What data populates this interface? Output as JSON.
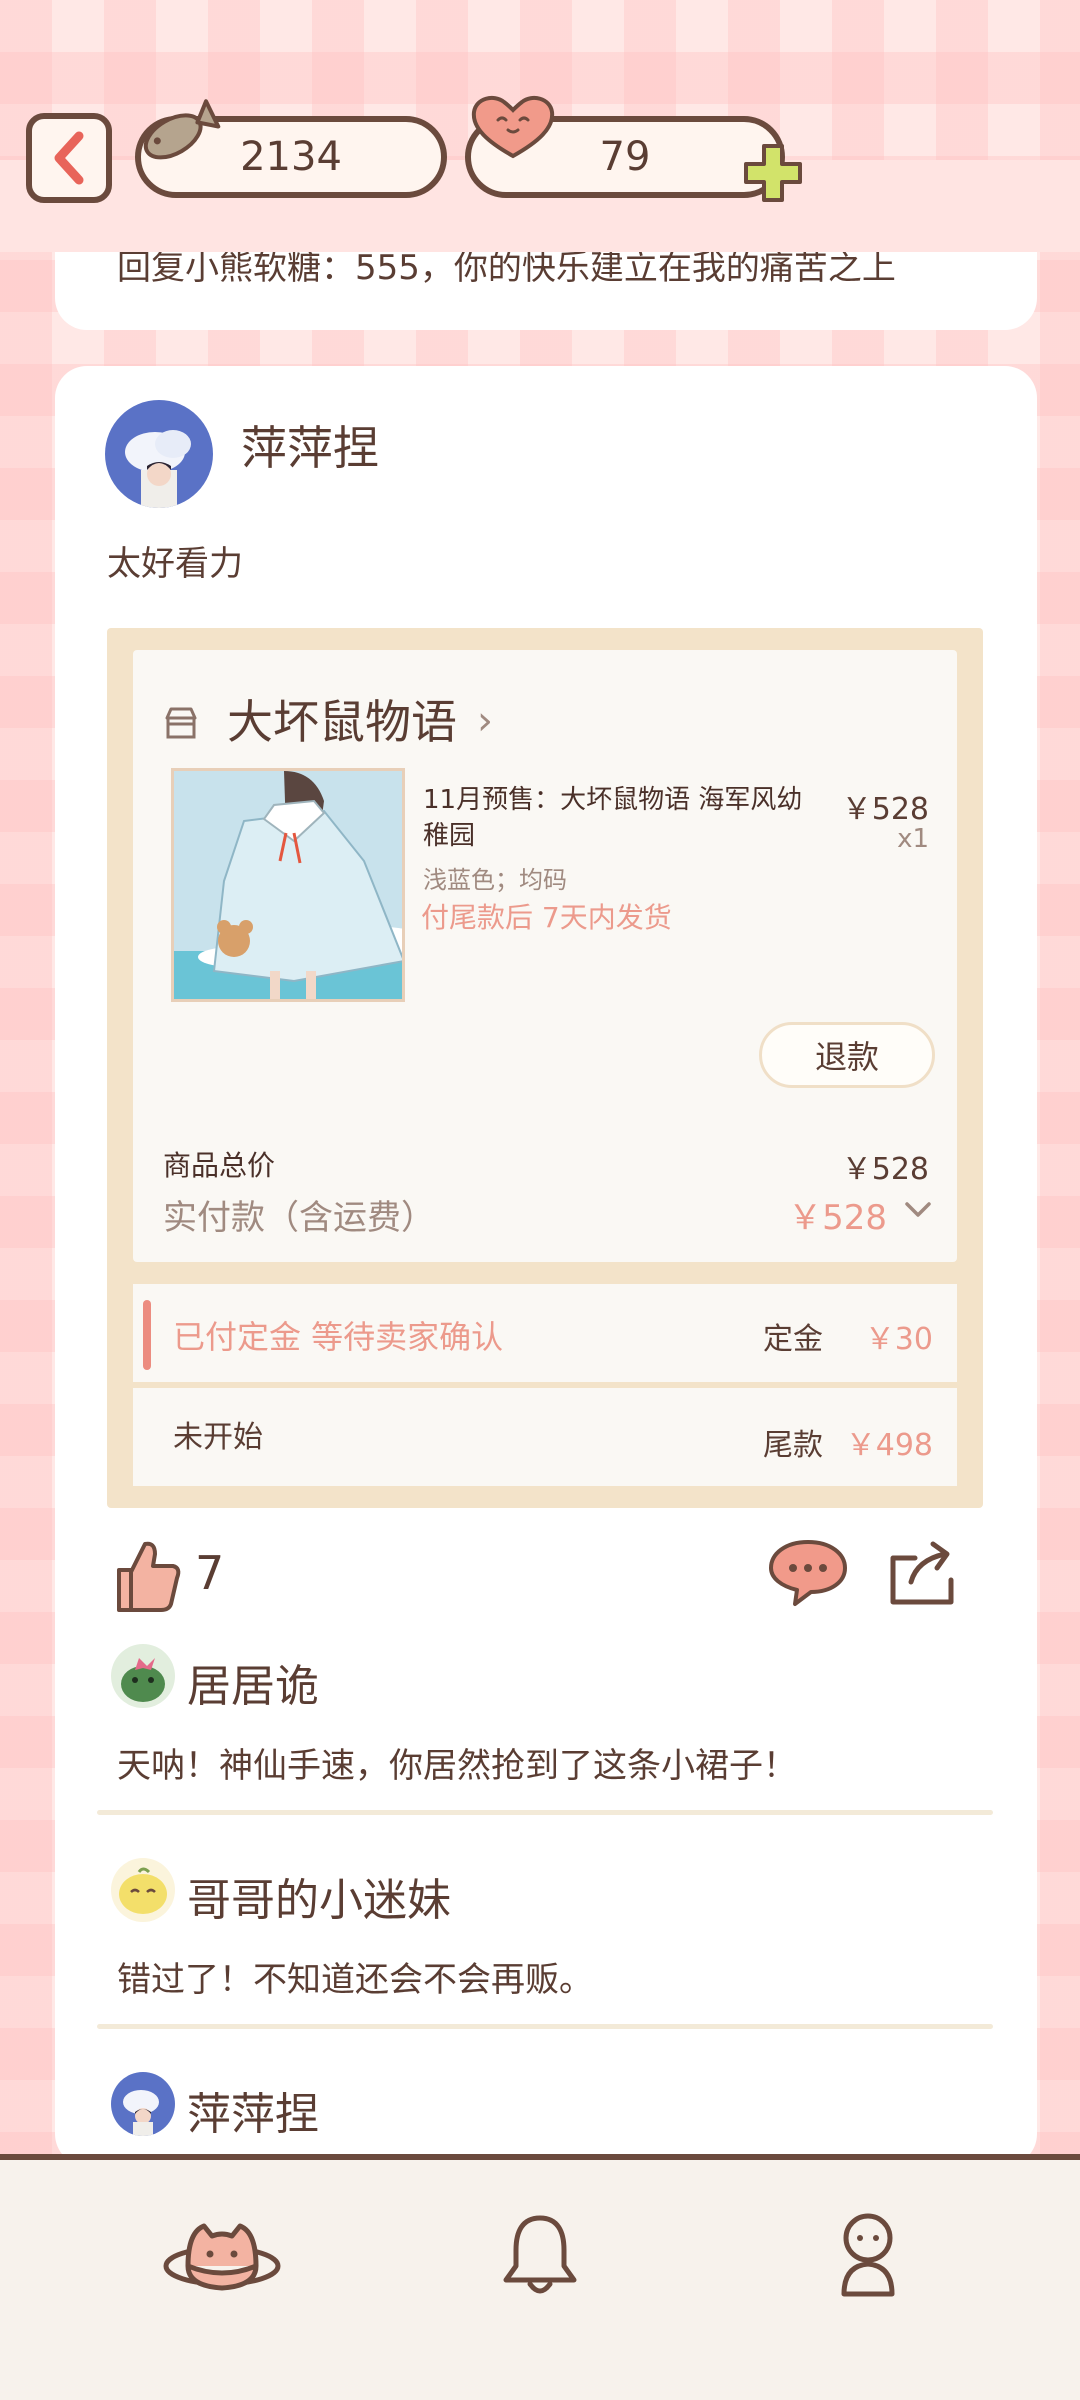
{
  "top_bar": {
    "back_icon": "back-chevron-icon",
    "fish_count": "2134",
    "heart_count": "79",
    "add_icon": "plus-icon"
  },
  "previous_card": {
    "text": "回复小熊软糖：555，你的快乐建立在我的痛苦之上"
  },
  "post": {
    "author": "萍萍捏",
    "text": "太好看力",
    "order": {
      "shop_name": "大坏鼠物语",
      "shop_chevron": "›",
      "product_title": "11月预售：大坏鼠物语 海军风幼稚园",
      "price": "￥528",
      "quantity": "x1",
      "variant": "浅蓝色；均码",
      "shipping_note": "付尾款后 7天内发货",
      "refund_label": "退款",
      "subtotal_label": "商品总价",
      "subtotal_value": "￥528",
      "paid_label": "实付款（含运费）",
      "paid_value": "￥528",
      "stages": [
        {
          "status": "已付定金 等待卖家确认",
          "kind": "定金",
          "amount": "￥30"
        },
        {
          "status": "未开始",
          "kind": "尾款",
          "amount": "￥498"
        }
      ]
    },
    "likes": "7",
    "comments": [
      {
        "author": "居居诡",
        "text": "天呐！神仙手速，你居然抢到了这条小裙子！"
      },
      {
        "author": "哥哥的小迷妹",
        "text": "错过了！不知道还会不会再贩。"
      },
      {
        "author": "萍萍捏",
        "text": ""
      }
    ]
  },
  "bottom_nav": [
    {
      "icon": "planet-cat-icon"
    },
    {
      "icon": "bell-icon"
    },
    {
      "icon": "person-icon"
    }
  ],
  "colors": {
    "brown": "#6b4a3d",
    "accent_pink": "#ec9a8c",
    "card": "#ffffff",
    "order_frame": "#f3e3c9"
  }
}
